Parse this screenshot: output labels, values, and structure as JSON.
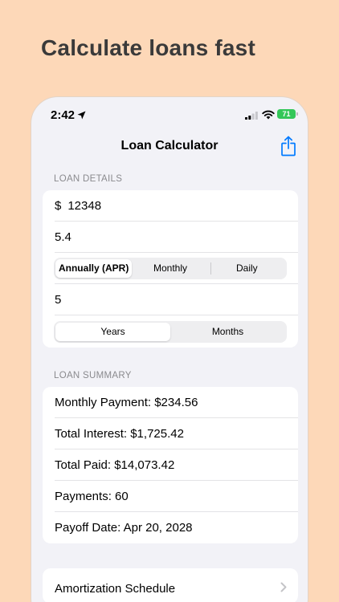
{
  "headline": "Calculate loans fast",
  "status_bar": {
    "time": "2:42",
    "battery": "71"
  },
  "nav": {
    "title": "Loan Calculator"
  },
  "loan_details": {
    "header": "LOAN DETAILS",
    "currency_symbol": "$",
    "amount": "12348",
    "rate": "5.4",
    "rate_period_options": [
      "Annually (APR)",
      "Monthly",
      "Daily"
    ],
    "rate_period_selected": "Annually (APR)",
    "term": "5",
    "term_unit_options": [
      "Years",
      "Months"
    ],
    "term_unit_selected": "Years"
  },
  "loan_summary": {
    "header": "LOAN SUMMARY",
    "monthly_payment": "Monthly Payment: $234.56",
    "total_interest": "Total Interest: $1,725.42",
    "total_paid": "Total Paid: $14,073.42",
    "payments": "Payments: 60",
    "payoff_date": "Payoff Date: Apr 20, 2028"
  },
  "amortization": {
    "label": "Amortization Schedule"
  },
  "colors": {
    "background": "#fdd8b8",
    "accent": "#007aff",
    "battery": "#34c759"
  }
}
